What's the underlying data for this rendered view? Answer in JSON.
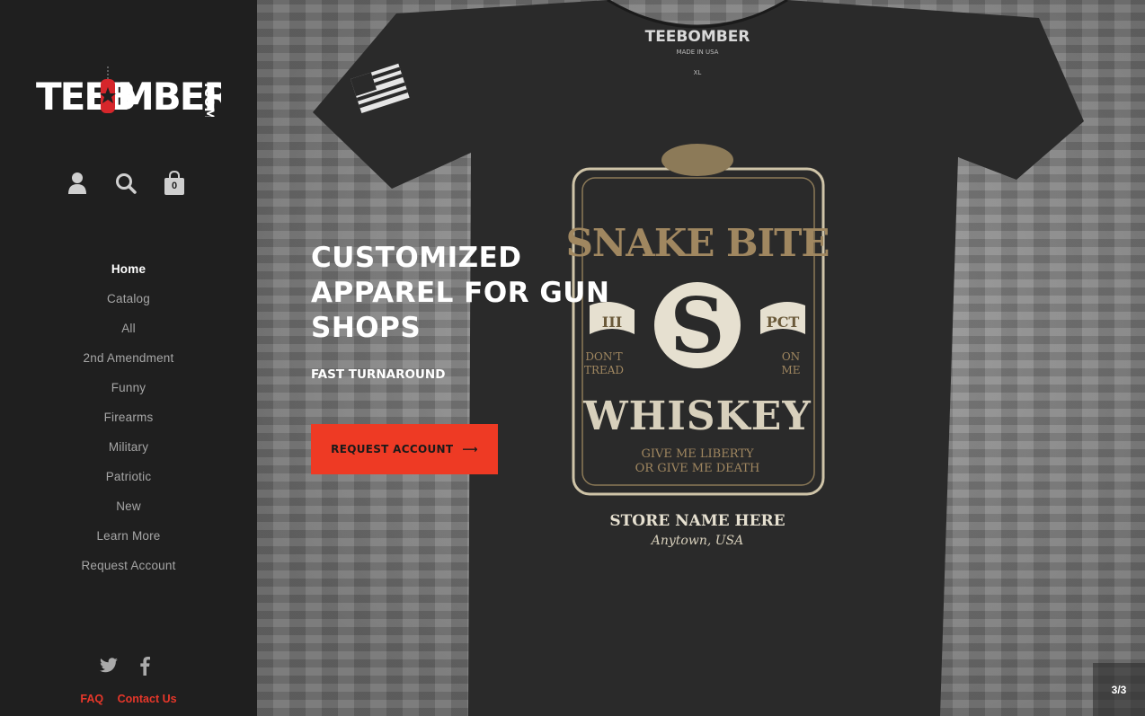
{
  "brand": {
    "logo_text": "TEEBOMBER.COM",
    "accent_color": "#ee3a24"
  },
  "header_icons": {
    "account": "account-icon",
    "search": "search-icon",
    "cart": "cart-icon",
    "cart_count": "0"
  },
  "nav": {
    "items": [
      {
        "label": "Home",
        "active": true
      },
      {
        "label": "Catalog"
      },
      {
        "label": "All"
      },
      {
        "label": "2nd Amendment"
      },
      {
        "label": "Funny"
      },
      {
        "label": "Firearms"
      },
      {
        "label": "Military"
      },
      {
        "label": "Patriotic"
      },
      {
        "label": "New"
      },
      {
        "label": "Learn More"
      },
      {
        "label": "Request Account"
      }
    ]
  },
  "social": {
    "twitter": "twitter-icon",
    "facebook": "facebook-icon"
  },
  "footer": {
    "faq": "FAQ",
    "contact": "Contact Us"
  },
  "hero": {
    "title": "CUSTOMIZED APPAREL FOR GUN SHOPS",
    "subtitle": "FAST TURNAROUND",
    "cta_label": "REQUEST ACCOUNT",
    "cta_arrow": "⟶",
    "slide_counter": "3/3",
    "shirt": {
      "tag_brand": "TEEBOMBER",
      "tag_made": "MADE IN USA",
      "tag_size": "XL",
      "design_top": "SNAKE BITE",
      "design_left_num": "III",
      "design_right_num": "PCT",
      "design_left_small_1": "DON'T",
      "design_left_small_2": "TREAD",
      "design_right_small_1": "ON",
      "design_right_small_2": "ME",
      "design_main": "WHISKEY",
      "design_motto_1": "GIVE ME LIBERTY",
      "design_motto_2": "OR GIVE ME DEATH",
      "store_name": "STORE NAME HERE",
      "store_city": "Anytown, USA"
    }
  }
}
